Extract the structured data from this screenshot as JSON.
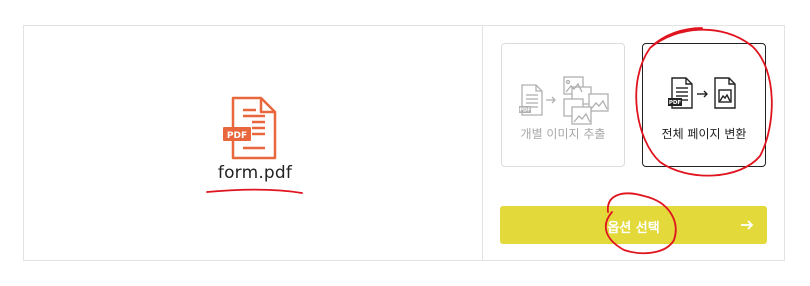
{
  "file": {
    "name": "form.pdf",
    "badge": "PDF",
    "icon": "pdf-file-icon"
  },
  "options": [
    {
      "label": "개별 이미지 추출",
      "selected": false,
      "icon": "extract-images-icon"
    },
    {
      "label": "전체 페이지 변환",
      "selected": true,
      "icon": "convert-pages-icon"
    }
  ],
  "action": {
    "label": "옵션 선택",
    "icon": "arrow-right-icon",
    "color": "#e3d93a"
  },
  "colors": {
    "pdf": "#e9673d",
    "annotation": "#e0141e"
  }
}
